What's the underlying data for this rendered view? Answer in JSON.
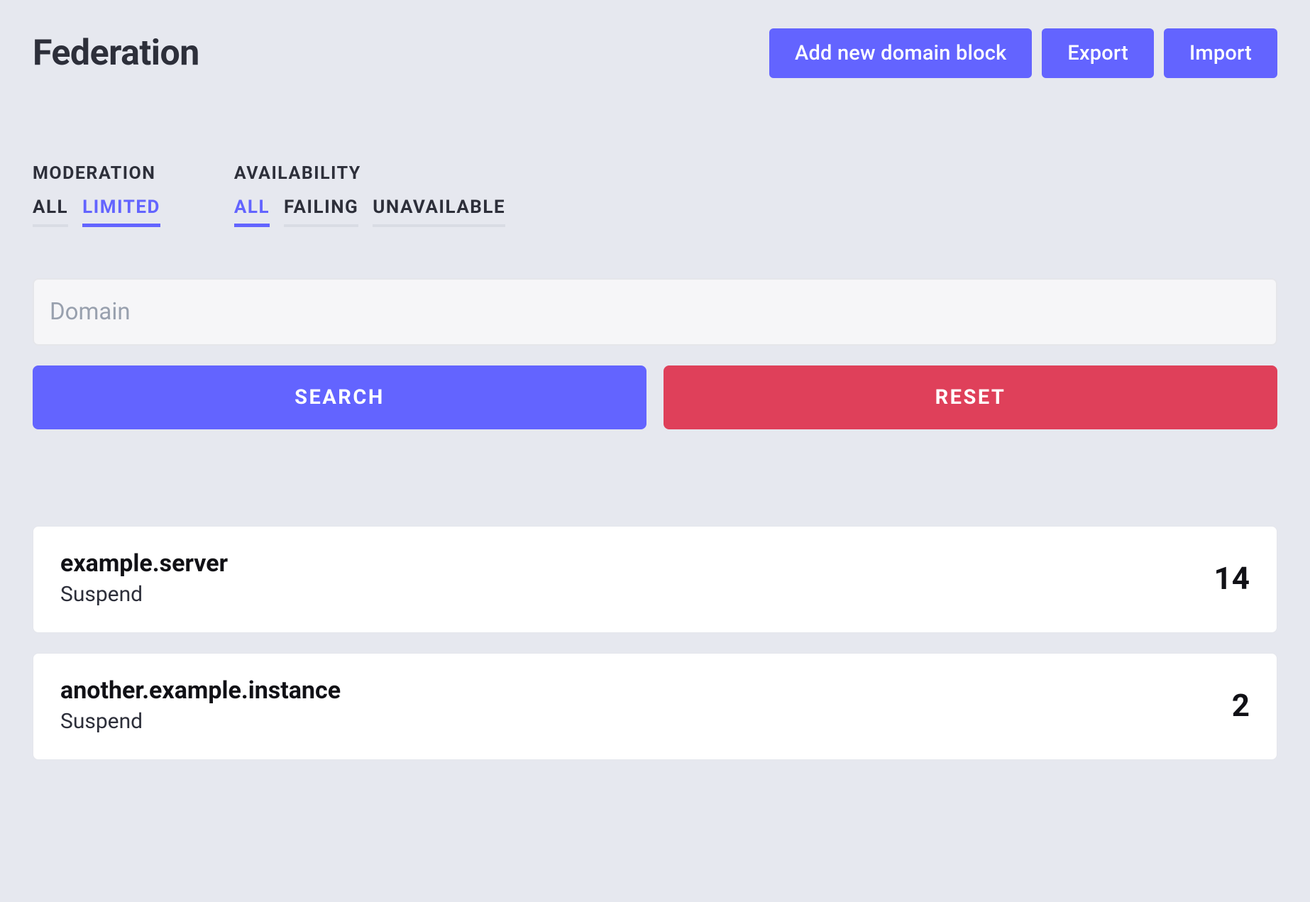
{
  "header": {
    "title": "Federation",
    "actions": {
      "add": "Add new domain block",
      "export": "Export",
      "import": "Import"
    }
  },
  "filters": {
    "moderation": {
      "label": "MODERATION",
      "options": [
        {
          "label": "ALL",
          "selected": false
        },
        {
          "label": "LIMITED",
          "selected": true
        }
      ]
    },
    "availability": {
      "label": "AVAILABILITY",
      "options": [
        {
          "label": "ALL",
          "selected": true
        },
        {
          "label": "FAILING",
          "selected": false
        },
        {
          "label": "UNAVAILABLE",
          "selected": false
        }
      ]
    }
  },
  "search": {
    "placeholder": "Domain",
    "value": "",
    "search_label": "SEARCH",
    "reset_label": "RESET"
  },
  "domains": [
    {
      "name": "example.server",
      "status": "Suspend",
      "count": "14"
    },
    {
      "name": "another.example.instance",
      "status": "Suspend",
      "count": "2"
    }
  ]
}
